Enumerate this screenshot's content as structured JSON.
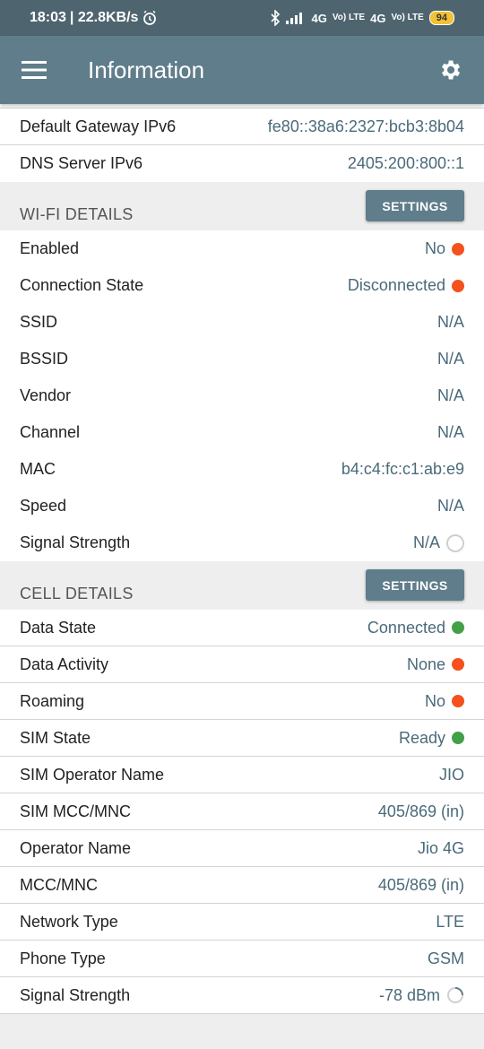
{
  "statusbar": {
    "time": "18:03",
    "speed": "| 22.8KB/s",
    "net1": "4G",
    "net2": "4G",
    "volte": "Vo) LTE",
    "battery": "94"
  },
  "appbar": {
    "title": "Information"
  },
  "top_rows": [
    {
      "label": "Default Gateway IPv6",
      "value": "fe80::38a6:2327:bcb3:8b04"
    },
    {
      "label": "DNS Server IPv6",
      "value": "2405:200:800::1"
    }
  ],
  "wifi": {
    "title": "WI-FI DETAILS",
    "button": "SETTINGS",
    "rows": [
      {
        "label": "Enabled",
        "value": "No",
        "indicator": "orange"
      },
      {
        "label": "Connection State",
        "value": "Disconnected",
        "indicator": "orange"
      },
      {
        "label": "SSID",
        "value": "N/A"
      },
      {
        "label": "BSSID",
        "value": "N/A"
      },
      {
        "label": "Vendor",
        "value": "N/A"
      },
      {
        "label": "Channel",
        "value": "N/A"
      },
      {
        "label": "MAC",
        "value": "b4:c4:fc:c1:ab:e9"
      },
      {
        "label": "Speed",
        "value": "N/A"
      },
      {
        "label": "Signal Strength",
        "value": "N/A",
        "indicator": "ring"
      }
    ]
  },
  "cell": {
    "title": "CELL DETAILS",
    "button": "SETTINGS",
    "rows": [
      {
        "label": "Data State",
        "value": "Connected",
        "indicator": "green"
      },
      {
        "label": "Data Activity",
        "value": "None",
        "indicator": "orange"
      },
      {
        "label": "Roaming",
        "value": "No",
        "indicator": "orange"
      },
      {
        "label": "SIM State",
        "value": "Ready",
        "indicator": "green"
      },
      {
        "label": "SIM Operator Name",
        "value": "JIO"
      },
      {
        "label": "SIM MCC/MNC",
        "value": "405/869 (in)"
      },
      {
        "label": "Operator Name",
        "value": "Jio 4G"
      },
      {
        "label": "MCC/MNC",
        "value": "405/869 (in)"
      },
      {
        "label": "Network Type",
        "value": "LTE"
      },
      {
        "label": "Phone Type",
        "value": "GSM"
      },
      {
        "label": "Signal Strength",
        "value": "-78 dBm",
        "indicator": "spinner"
      }
    ]
  },
  "colors": {
    "orange": "#f4511e",
    "green": "#43a047",
    "appbar": "#607d8b",
    "statusbar": "#4e6570"
  },
  "icons": {
    "menu": "hamburger-icon",
    "settings": "gear-icon"
  }
}
